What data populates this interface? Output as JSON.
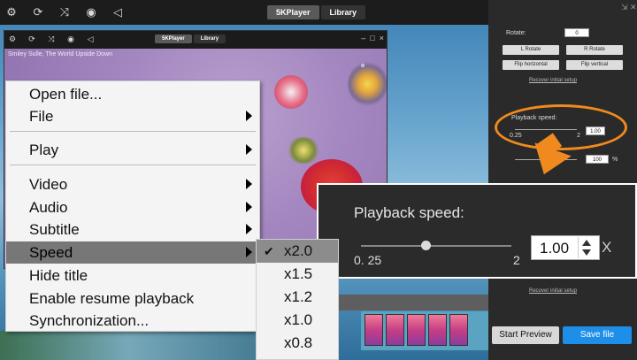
{
  "topbar": {
    "tabs": [
      "5KPlayer",
      "Library"
    ],
    "icons": [
      "settings-icon",
      "refresh-icon",
      "shuffle-icon",
      "dvd-icon",
      "sound-icon"
    ]
  },
  "inner_window": {
    "tabs": [
      "5KPlayer",
      "Library"
    ],
    "title": "Smiley Sulle, The World Upside Down"
  },
  "menu": {
    "items": [
      "Open file...",
      "File",
      "Play",
      "Video",
      "Audio",
      "Subtitle",
      "Speed",
      "Hide title",
      "Enable resume playback",
      "Synchronization..."
    ],
    "selected": "Speed"
  },
  "speed_submenu": {
    "options": [
      "x2.0",
      "x1.5",
      "x1.2",
      "x1.0",
      "x0.8"
    ],
    "selected": "x2.0"
  },
  "settings_panel": {
    "rotate_label": "Rotate:",
    "rotate_value": "0",
    "l_rotate": "L Rotate",
    "r_rotate": "R Rotate",
    "flip_h": "Flip horizontal",
    "flip_v": "Flip vertical",
    "recover_link": "Recover initial setup",
    "playback_label": "Playback speed:",
    "playback_min": "0.25",
    "playback_max": "2",
    "playback_value": "1.00",
    "percent_value": "100",
    "percent_unit": "%",
    "recover_link2": "Recover initial setup"
  },
  "zoom_panel": {
    "title": "Playback speed:",
    "min_label": "0. 25",
    "max_label": "2",
    "value": "1.00",
    "unit": "X",
    "slider_fraction": 0.43
  },
  "buttons": {
    "start_preview": "Start Preview",
    "save_file": "Save file"
  },
  "colors": {
    "accent_orange": "#f08a1e",
    "save_blue": "#1e8fe8"
  }
}
